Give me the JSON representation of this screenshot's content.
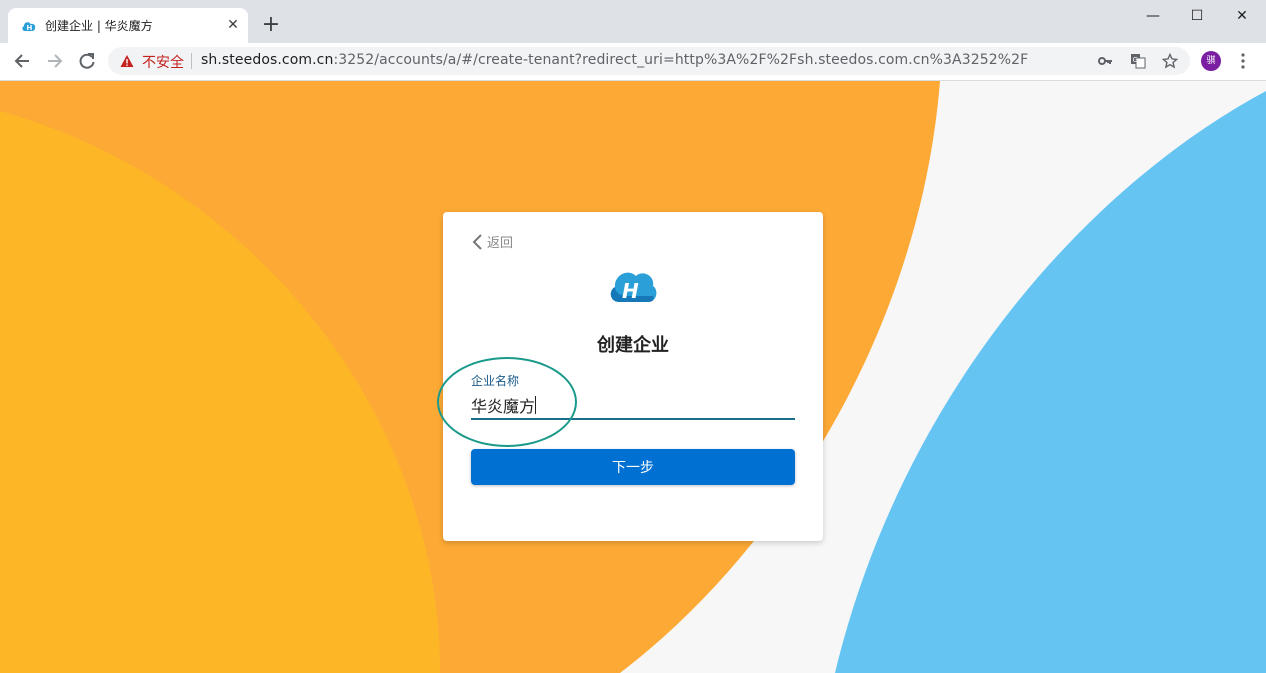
{
  "browser": {
    "tab_title": "创建企业 | 华炎魔方",
    "security_label": "不安全",
    "url_host": "sh.steedos.com.cn",
    "url_rest": ":3252/accounts/a/#/create-tenant?redirect_uri=http%3A%2F%2Fsh.steedos.com.cn%3A3252%2F",
    "profile_initial": "骐"
  },
  "form": {
    "back_label": "返回",
    "title": "创建企业",
    "field_label": "企业名称",
    "field_value": "华炎魔方",
    "submit_label": "下一步"
  },
  "colors": {
    "orange": "#fda935",
    "yellow": "#fdb726",
    "blue": "#66c4f3",
    "button": "#0070d2",
    "highlight": "#1a9a8a"
  }
}
